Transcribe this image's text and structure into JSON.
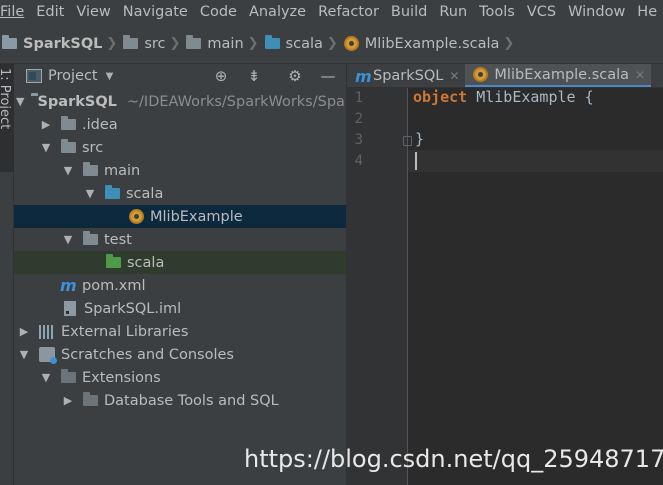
{
  "menu": [
    "File",
    "Edit",
    "View",
    "Navigate",
    "Code",
    "Analyze",
    "Refactor",
    "Build",
    "Run",
    "Tools",
    "VCS",
    "Window",
    "He"
  ],
  "breadcrumbs": [
    "SparkSQL",
    "src",
    "main",
    "scala",
    "MlibExample.scala"
  ],
  "left_strip": {
    "tab_label": "1: Project"
  },
  "project_panel": {
    "title": "Project",
    "header_icons": [
      "locate-icon",
      "collapse-all-icon",
      "gear-icon",
      "hide-icon"
    ],
    "tree": [
      {
        "label": "SparkSQL",
        "path": "~/IDEAWorks/SparkWorks/SparkSQL",
        "arrow": "down",
        "icon": "project-folder-icon"
      },
      {
        "label": ".idea",
        "arrow": "right",
        "icon": "folder-icon"
      },
      {
        "label": "src",
        "arrow": "down",
        "icon": "folder-icon"
      },
      {
        "label": "main",
        "arrow": "down",
        "icon": "folder-icon"
      },
      {
        "label": "scala",
        "arrow": "down",
        "icon": "source-folder-icon"
      },
      {
        "label": "MlibExample",
        "arrow": "",
        "icon": "scala-object-icon"
      },
      {
        "label": "test",
        "arrow": "down",
        "icon": "folder-icon"
      },
      {
        "label": "scala",
        "arrow": "",
        "icon": "test-folder-icon"
      },
      {
        "label": "pom.xml",
        "arrow": "",
        "icon": "maven-icon"
      },
      {
        "label": "SparkSQL.iml",
        "arrow": "",
        "icon": "iml-file-icon"
      },
      {
        "label": "External Libraries",
        "arrow": "right",
        "icon": "libraries-icon"
      },
      {
        "label": "Scratches and Consoles",
        "arrow": "down",
        "icon": "scratches-icon"
      },
      {
        "label": "Extensions",
        "arrow": "down",
        "icon": "folder-icon"
      },
      {
        "label": "Database Tools and SQL",
        "arrow": "right",
        "icon": "folder-icon"
      }
    ]
  },
  "editor_tabs": [
    {
      "label": "SparkSQL",
      "icon": "maven-icon",
      "active": false
    },
    {
      "label": "MlibExample.scala",
      "icon": "scala-object-icon",
      "active": true
    }
  ],
  "editor": {
    "line_numbers": [
      "1",
      "2",
      "3",
      "4"
    ],
    "line1_keyword": "object",
    "line1_rest": " MlibExample {",
    "line3": "}"
  },
  "watermark": "https://blog.csdn.net/qq_25948717",
  "colors": {
    "accent": "#4a88c7",
    "selection": "#0d293e",
    "keyword": "#cc7832"
  }
}
